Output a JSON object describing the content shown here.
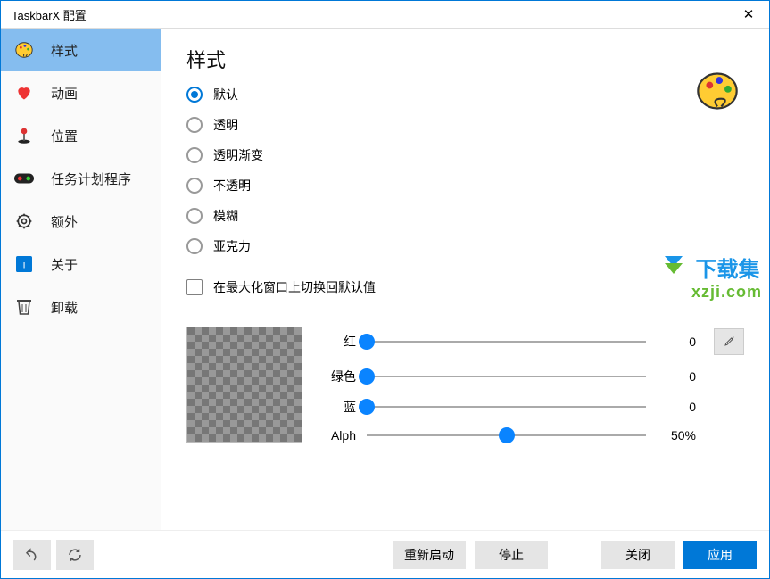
{
  "window": {
    "title": "TaskbarX 配置"
  },
  "sidebar": {
    "items": [
      {
        "label": "样式"
      },
      {
        "label": "动画"
      },
      {
        "label": "位置"
      },
      {
        "label": "任务计划程序"
      },
      {
        "label": "额外"
      },
      {
        "label": "关于"
      },
      {
        "label": "卸载"
      }
    ]
  },
  "main": {
    "title": "样式",
    "radios": [
      {
        "label": "默认"
      },
      {
        "label": "透明"
      },
      {
        "label": "透明渐变"
      },
      {
        "label": "不透明"
      },
      {
        "label": "模糊"
      },
      {
        "label": "亚克力"
      }
    ],
    "checkbox_label": "在最大化窗口上切换回默认值",
    "sliders": {
      "red": {
        "label": "红",
        "value": "0",
        "pos": 0
      },
      "green": {
        "label": "绿色",
        "value": "0",
        "pos": 0
      },
      "blue": {
        "label": "蓝",
        "value": "0",
        "pos": 0
      },
      "alpha": {
        "label": "Alph",
        "value": "50%",
        "pos": 50
      }
    }
  },
  "footer": {
    "restart": "重新启动",
    "stop": "停止",
    "close": "关闭",
    "apply": "应用"
  },
  "watermark": {
    "line1": "下载集",
    "line2": "xzji.com"
  }
}
